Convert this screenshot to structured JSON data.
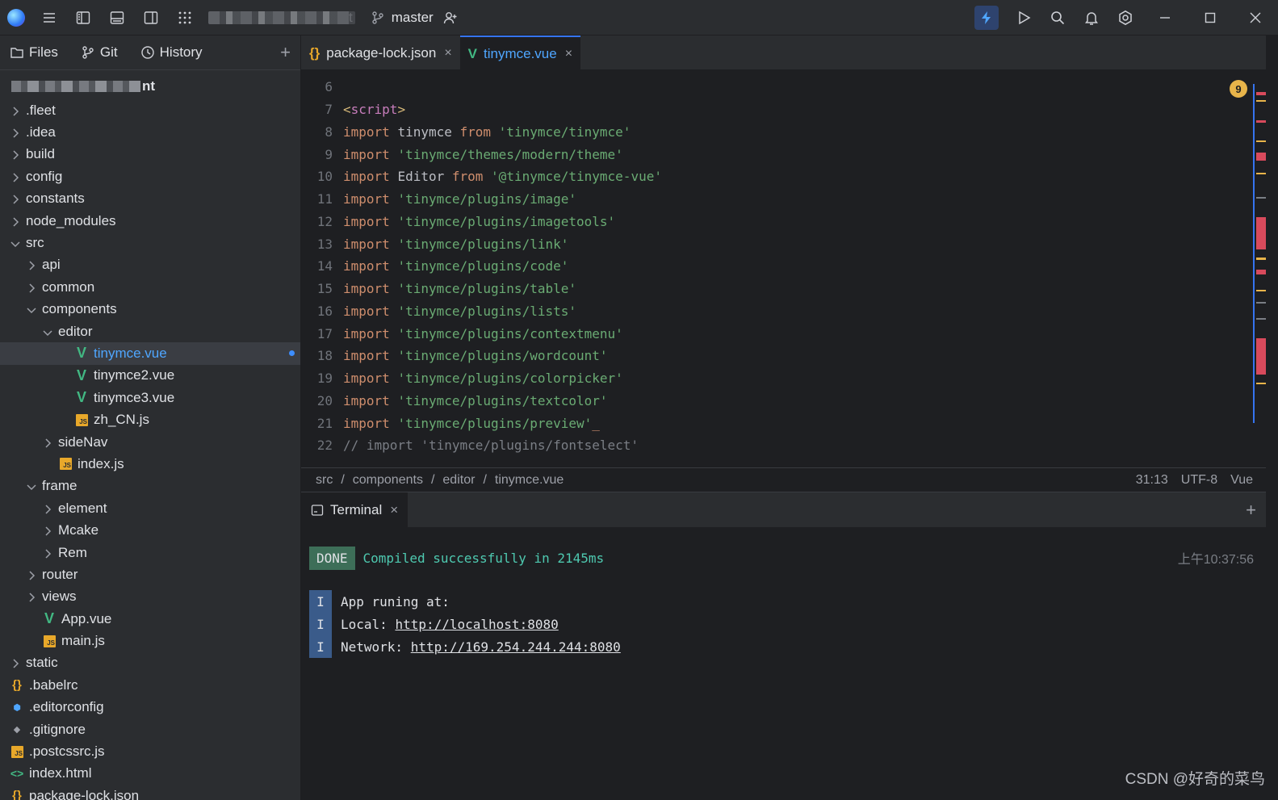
{
  "titlebar": {
    "branch": "master",
    "tb_suffix": "t"
  },
  "left_panel": {
    "tabs": [
      {
        "label": "Files",
        "icon": "folder-icon"
      },
      {
        "label": "Git",
        "icon": "git-branch-icon"
      },
      {
        "label": "History",
        "icon": "clock-icon"
      }
    ],
    "root_suffix": "nt",
    "tree": [
      {
        "label": ".fleet",
        "type": "folder",
        "depth": 0,
        "expanded": false
      },
      {
        "label": ".idea",
        "type": "folder",
        "depth": 0,
        "expanded": false
      },
      {
        "label": "build",
        "type": "folder",
        "depth": 0,
        "expanded": false
      },
      {
        "label": "config",
        "type": "folder",
        "depth": 0,
        "expanded": false
      },
      {
        "label": "constants",
        "type": "folder",
        "depth": 0,
        "expanded": false
      },
      {
        "label": "node_modules",
        "type": "folder",
        "depth": 0,
        "expanded": false
      },
      {
        "label": "src",
        "type": "folder",
        "depth": 0,
        "expanded": true
      },
      {
        "label": "api",
        "type": "folder",
        "depth": 1,
        "expanded": false
      },
      {
        "label": "common",
        "type": "folder",
        "depth": 1,
        "expanded": false
      },
      {
        "label": "components",
        "type": "folder",
        "depth": 1,
        "expanded": true
      },
      {
        "label": "editor",
        "type": "folder",
        "depth": 2,
        "expanded": true
      },
      {
        "label": "tinymce.vue",
        "type": "vue",
        "depth": 3,
        "selected": true,
        "modified": true
      },
      {
        "label": "tinymce2.vue",
        "type": "vue",
        "depth": 3
      },
      {
        "label": "tinymce3.vue",
        "type": "vue",
        "depth": 3
      },
      {
        "label": "zh_CN.js",
        "type": "js",
        "depth": 3
      },
      {
        "label": "sideNav",
        "type": "folder",
        "depth": 2,
        "expanded": false
      },
      {
        "label": "index.js",
        "type": "js",
        "depth": 2
      },
      {
        "label": "frame",
        "type": "folder",
        "depth": 1,
        "expanded": true
      },
      {
        "label": "element",
        "type": "folder",
        "depth": 2,
        "expanded": false
      },
      {
        "label": "Mcake",
        "type": "folder",
        "depth": 2,
        "expanded": false
      },
      {
        "label": "Rem",
        "type": "folder",
        "depth": 2,
        "expanded": false
      },
      {
        "label": "router",
        "type": "folder",
        "depth": 1,
        "expanded": false
      },
      {
        "label": "views",
        "type": "folder",
        "depth": 1,
        "expanded": false
      },
      {
        "label": "App.vue",
        "type": "vue",
        "depth": 1
      },
      {
        "label": "main.js",
        "type": "js",
        "depth": 1
      },
      {
        "label": "static",
        "type": "folder",
        "depth": 0,
        "expanded": false
      },
      {
        "label": ".babelrc",
        "type": "json",
        "depth": 0
      },
      {
        "label": ".editorconfig",
        "type": "cfg",
        "depth": 0
      },
      {
        "label": ".gitignore",
        "type": "git",
        "depth": 0
      },
      {
        "label": ".postcssrc.js",
        "type": "js",
        "depth": 0
      },
      {
        "label": "index.html",
        "type": "html",
        "depth": 0
      },
      {
        "label": "package-lock.json",
        "type": "json",
        "depth": 0
      }
    ]
  },
  "editor": {
    "tabs": [
      {
        "label": "package-lock.json",
        "icon": "json-braces-icon",
        "active": false
      },
      {
        "label": "tinymce.vue",
        "icon": "vue-icon",
        "active": true
      }
    ],
    "warning_count": "9",
    "lines": [
      {
        "n": "6",
        "parts": []
      },
      {
        "n": "7",
        "parts": [
          {
            "c": "tag",
            "t": "<"
          },
          {
            "c": "kw2",
            "t": "script"
          },
          {
            "c": "tag",
            "t": ">"
          }
        ]
      },
      {
        "n": "8",
        "parts": [
          {
            "c": "kw",
            "t": "import "
          },
          {
            "c": "plain",
            "t": "tinymce "
          },
          {
            "c": "kw",
            "t": "from "
          },
          {
            "c": "str",
            "t": "'tinymce/tinymce'"
          }
        ]
      },
      {
        "n": "9",
        "parts": [
          {
            "c": "kw",
            "t": "import "
          },
          {
            "c": "str",
            "t": "'tinymce/themes/modern/theme'"
          }
        ]
      },
      {
        "n": "10",
        "parts": [
          {
            "c": "kw",
            "t": "import "
          },
          {
            "c": "plain",
            "t": "Editor "
          },
          {
            "c": "kw",
            "t": "from "
          },
          {
            "c": "str",
            "t": "'@tinymce/tinymce-vue'"
          }
        ]
      },
      {
        "n": "11",
        "parts": [
          {
            "c": "kw",
            "t": "import "
          },
          {
            "c": "str",
            "t": "'tinymce/plugins/image'"
          }
        ]
      },
      {
        "n": "12",
        "parts": [
          {
            "c": "kw",
            "t": "import "
          },
          {
            "c": "str",
            "t": "'tinymce/plugins/imagetools'"
          }
        ]
      },
      {
        "n": "13",
        "parts": [
          {
            "c": "kw",
            "t": "import "
          },
          {
            "c": "str",
            "t": "'tinymce/plugins/link'"
          }
        ]
      },
      {
        "n": "14",
        "parts": [
          {
            "c": "kw",
            "t": "import "
          },
          {
            "c": "str",
            "t": "'tinymce/plugins/code'"
          }
        ]
      },
      {
        "n": "15",
        "parts": [
          {
            "c": "kw",
            "t": "import "
          },
          {
            "c": "str",
            "t": "'tinymce/plugins/table'"
          }
        ]
      },
      {
        "n": "16",
        "parts": [
          {
            "c": "kw",
            "t": "import "
          },
          {
            "c": "str",
            "t": "'tinymce/plugins/lists'"
          }
        ]
      },
      {
        "n": "17",
        "parts": [
          {
            "c": "kw",
            "t": "import "
          },
          {
            "c": "str",
            "t": "'tinymce/plugins/contextmenu'"
          }
        ]
      },
      {
        "n": "18",
        "parts": [
          {
            "c": "kw",
            "t": "import "
          },
          {
            "c": "str",
            "t": "'tinymce/plugins/wordcount'"
          }
        ]
      },
      {
        "n": "19",
        "parts": [
          {
            "c": "kw",
            "t": "import "
          },
          {
            "c": "str",
            "t": "'tinymce/plugins/colorpicker'"
          }
        ]
      },
      {
        "n": "20",
        "parts": [
          {
            "c": "kw",
            "t": "import "
          },
          {
            "c": "str",
            "t": "'tinymce/plugins/textcolor'"
          }
        ]
      },
      {
        "n": "21",
        "parts": [
          {
            "c": "kw",
            "t": "import "
          },
          {
            "c": "str",
            "t": "'tinymce/plugins/preview'"
          },
          {
            "c": "kw",
            "t": "_"
          }
        ]
      },
      {
        "n": "22",
        "parts": [
          {
            "c": "cmt",
            "t": "// import 'tinymce/plugins/fontselect'"
          }
        ]
      }
    ],
    "breadcrumb": [
      "src",
      "components",
      "editor",
      "tinymce.vue"
    ],
    "status": {
      "position": "31:13",
      "encoding": "UTF-8",
      "language": "Vue"
    }
  },
  "terminal": {
    "tab_label": "Terminal",
    "done_badge": "DONE",
    "done_text": "Compiled successfully in 2145ms",
    "time": "上午10:37:56",
    "info_badge": "I",
    "info_lines": [
      {
        "label": "App runing at:",
        "link": ""
      },
      {
        "label": "Local: ",
        "link": "http://localhost:8080"
      },
      {
        "label": "Network: ",
        "link": "http://169.254.244.244:8080"
      }
    ]
  },
  "watermark": "CSDN @好奇的菜鸟",
  "colors": {
    "accent": "#3574f0",
    "link_blue": "#4fa6ff",
    "vue_green": "#42b883",
    "js_yellow": "#e8a82a"
  }
}
